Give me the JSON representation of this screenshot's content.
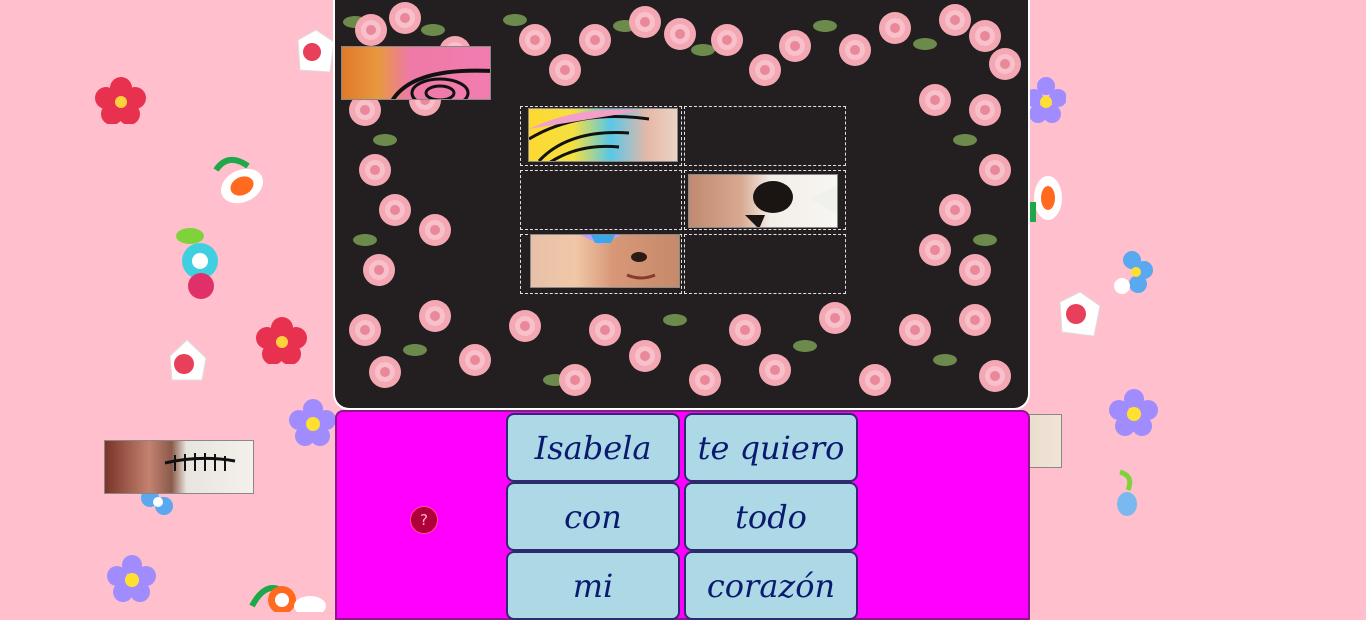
{
  "game": {
    "help_label": "?",
    "words": [
      "Isabela",
      "te quiero",
      "con",
      "todo",
      "mi",
      "corazón"
    ]
  },
  "colors": {
    "background": "#ffbfcc",
    "board": "#231f20",
    "tray": "#ff00ff",
    "word_button": "#add8e6",
    "word_text": "#0a1a6e"
  },
  "icons": [
    "flower-sticker-icon",
    "rose-garland",
    "help-icon"
  ]
}
